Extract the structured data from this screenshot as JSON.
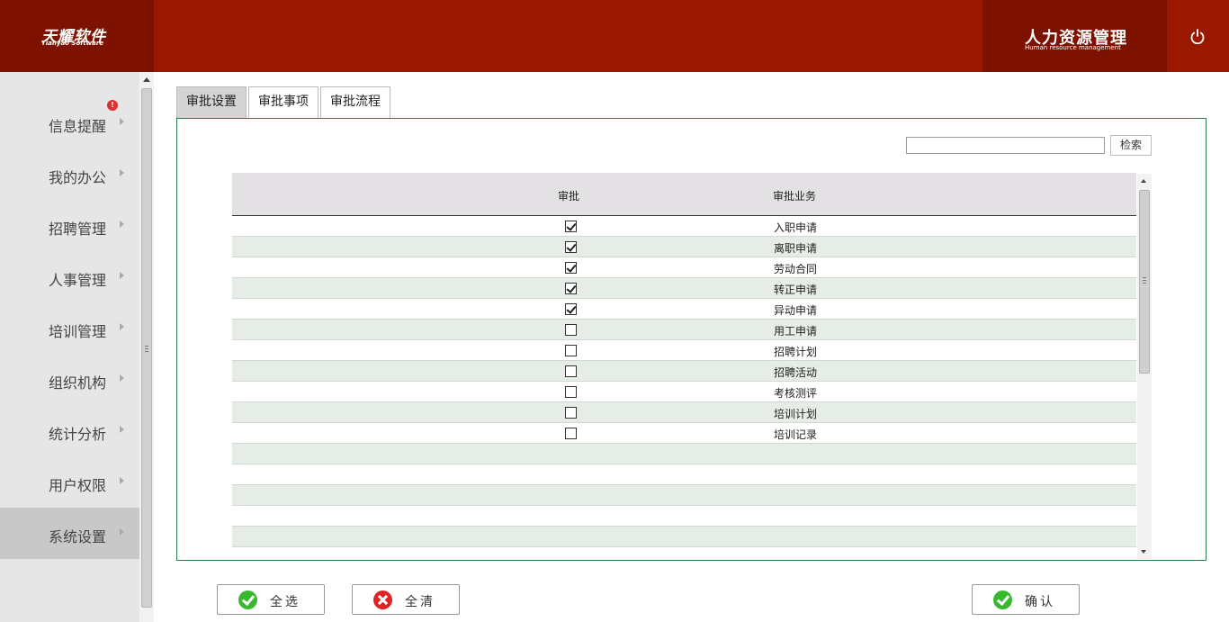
{
  "header": {
    "logo_cn": "天耀软件",
    "logo_en": "Tianyao Software",
    "system_cn": "人力资源管理",
    "system_en": "Human resource management",
    "power_icon": "power-icon"
  },
  "sidebar": {
    "items": [
      {
        "label": "信息提醒",
        "badge": "!"
      },
      {
        "label": "我的办公"
      },
      {
        "label": "招聘管理"
      },
      {
        "label": "人事管理"
      },
      {
        "label": "培训管理"
      },
      {
        "label": "组织机构"
      },
      {
        "label": "统计分析"
      },
      {
        "label": "用户权限"
      },
      {
        "label": "系统设置",
        "active": true
      }
    ]
  },
  "tabs": [
    {
      "label": "审批设置",
      "active": true
    },
    {
      "label": "审批事项"
    },
    {
      "label": "审批流程"
    }
  ],
  "search": {
    "value": "",
    "button_label": "检索"
  },
  "grid": {
    "columns": [
      "审批",
      "审批业务"
    ],
    "rows": [
      {
        "checked": true,
        "business": "入职申请"
      },
      {
        "checked": true,
        "business": "离职申请"
      },
      {
        "checked": true,
        "business": "劳动合同"
      },
      {
        "checked": true,
        "business": "转正申请"
      },
      {
        "checked": true,
        "business": "异动申请"
      },
      {
        "checked": false,
        "business": "用工申请"
      },
      {
        "checked": false,
        "business": "招聘计划"
      },
      {
        "checked": false,
        "business": "招聘活动"
      },
      {
        "checked": false,
        "business": "考核测评"
      },
      {
        "checked": false,
        "business": "培训计划"
      },
      {
        "checked": false,
        "business": "培训记录"
      }
    ]
  },
  "actions": {
    "select_all": "全选",
    "clear_all": "全清",
    "confirm": "确认"
  },
  "colors": {
    "header_bg": "#9a1800",
    "header_dark": "#7e1200",
    "panel_border": "#2e7d4f",
    "row_alt": "#e6ede6"
  }
}
